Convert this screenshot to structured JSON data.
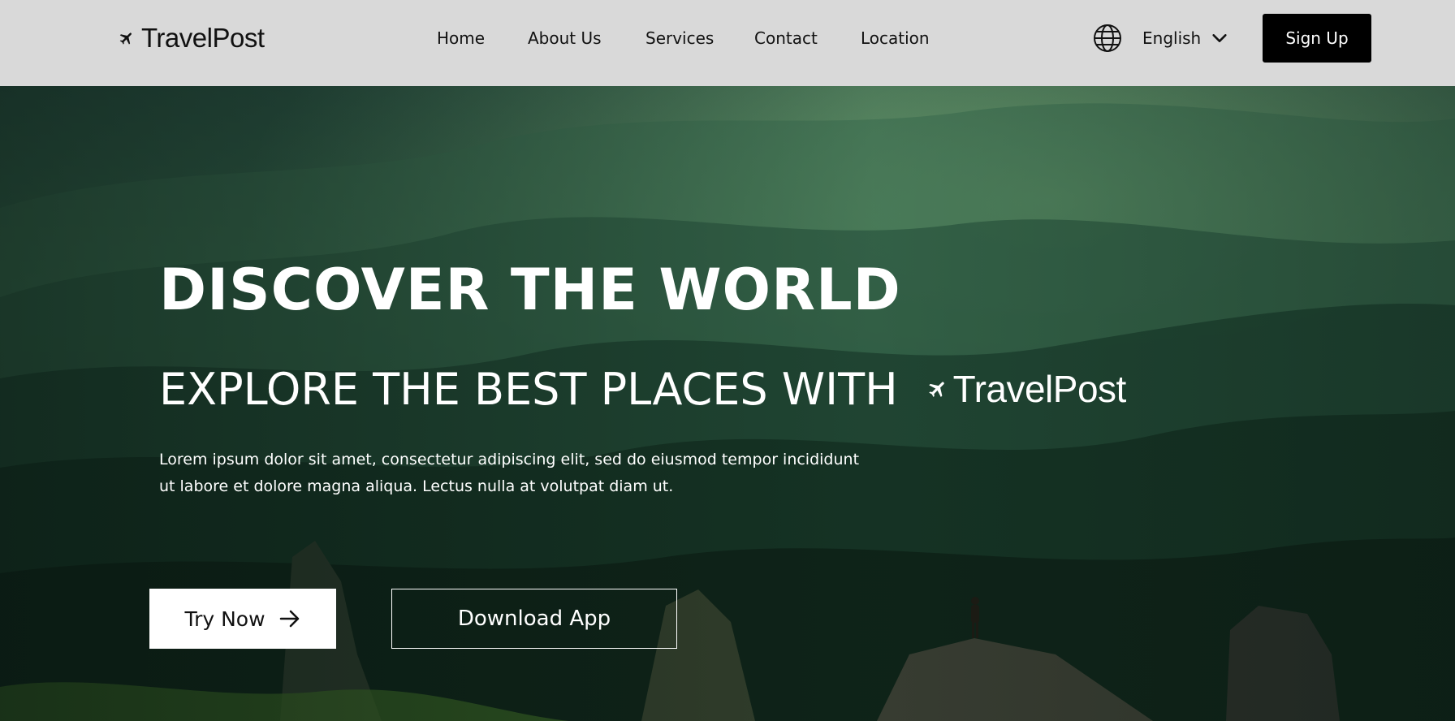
{
  "header": {
    "brand": "TravelPost",
    "nav": [
      {
        "label": "Home"
      },
      {
        "label": "About Us"
      },
      {
        "label": "Services"
      },
      {
        "label": "Contact"
      },
      {
        "label": "Location"
      }
    ],
    "language": "English",
    "signup_label": "Sign Up"
  },
  "hero": {
    "title": "DISCOVER THE WORLD",
    "subtitle": "EXPLORE THE BEST PLACES WITH",
    "subtitle_brand": "TravelPost",
    "description": "Lorem ipsum dolor sit amet, consectetur adipiscing elit, sed do eiusmod tempor incididunt ut labore et dolore magna aliqua. Lectus nulla at volutpat diam ut.",
    "try_label": "Try Now",
    "download_label": "Download App"
  },
  "colors": {
    "header_bg": "#d9d9d9",
    "signup_bg": "#000000",
    "hero_text": "#ffffff",
    "forest_dark": "#0d1f18",
    "forest_light": "#4f8a5a"
  },
  "icons": {
    "logo": "airplane-icon",
    "language": "globe-icon",
    "dropdown": "chevron-down-icon",
    "try": "arrow-right-icon"
  }
}
